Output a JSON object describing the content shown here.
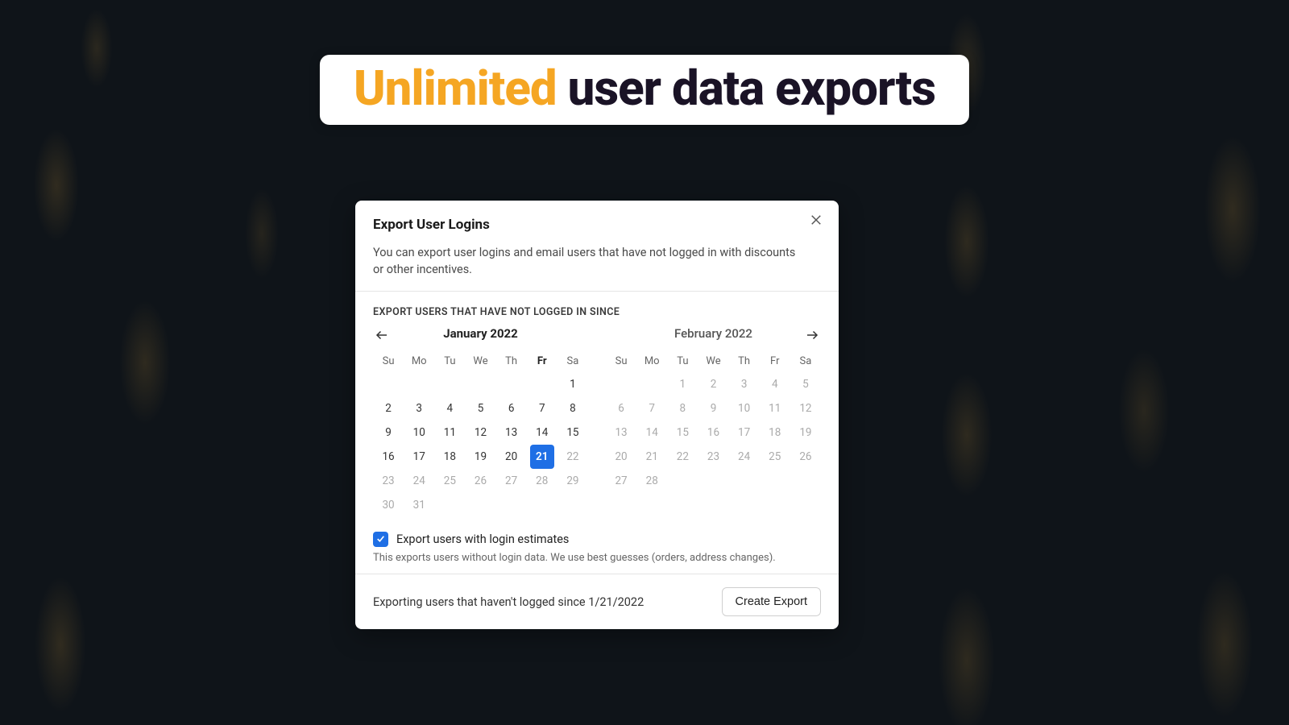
{
  "hero": {
    "accent": "Unlimited",
    "rest": " user data exports"
  },
  "modal": {
    "title": "Export User Logins",
    "description": "You can export user logins and email users that have not logged in with discounts or other incentives.",
    "section_label": "EXPORT USERS THAT HAVE NOT LOGGED IN SINCE",
    "dow": [
      "Su",
      "Mo",
      "Tu",
      "We",
      "Th",
      "Fr",
      "Sa"
    ],
    "current_dow_index": 5,
    "month1": {
      "title": "January 2022",
      "lead_blanks": 6,
      "days": 31,
      "selected": 21,
      "muted_after": 21
    },
    "month2": {
      "title": "February 2022",
      "lead_blanks": 2,
      "days": 28,
      "all_muted": true
    },
    "option": {
      "label": "Export users with login estimates",
      "help": "This exports users without login data. We use best guesses (orders, address changes).",
      "checked": true
    },
    "footer_text": "Exporting users that haven't logged since 1/21/2022",
    "create_label": "Create Export"
  }
}
